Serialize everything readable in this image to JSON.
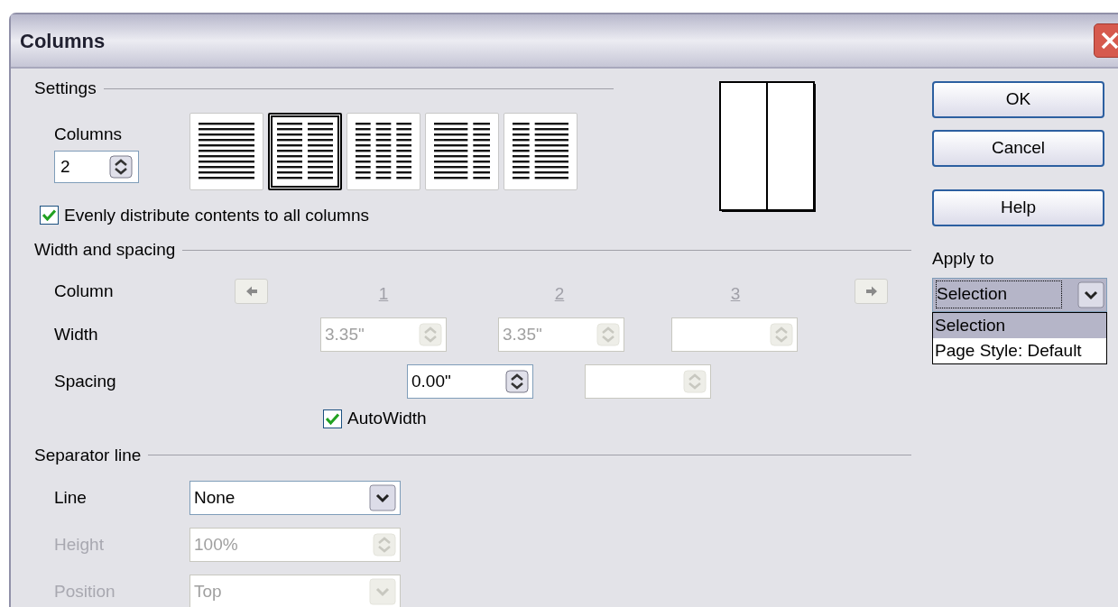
{
  "window": {
    "title": "Columns"
  },
  "settings": {
    "heading": "Settings",
    "columns": {
      "label": "Columns",
      "value": "2"
    },
    "layouts": [
      {
        "kind": "one",
        "selected": false
      },
      {
        "kind": "two",
        "selected": true
      },
      {
        "kind": "three",
        "selected": false
      },
      {
        "kind": "left-wide",
        "selected": false
      },
      {
        "kind": "right-wide",
        "selected": false
      }
    ],
    "evenly": {
      "label": "Evenly distribute contents to all columns",
      "checked": true
    }
  },
  "width_spacing": {
    "heading": "Width and spacing",
    "column_label": "Column",
    "column_numbers": [
      "1",
      "2",
      "3"
    ],
    "width_label": "Width",
    "widths": [
      {
        "value": "3.35\"",
        "disabled": true
      },
      {
        "value": "3.35\"",
        "disabled": true
      },
      {
        "disabled": true
      }
    ],
    "spacing_label": "Spacing",
    "spacings": [
      {
        "value": "0.00\"",
        "disabled": false
      },
      {
        "disabled": true
      }
    ],
    "autowidth": {
      "label": "AutoWidth",
      "checked": true
    }
  },
  "separator": {
    "heading": "Separator line",
    "rows": [
      {
        "label": "Line",
        "value": "None",
        "kind": "dropdown",
        "disabled": false
      },
      {
        "label": "Height",
        "value": "100%",
        "kind": "spin",
        "disabled": true
      },
      {
        "label": "Position",
        "value": "Top",
        "kind": "dropdown",
        "disabled": true
      }
    ]
  },
  "buttons": [
    {
      "label": "OK"
    },
    {
      "label": "Cancel"
    },
    {
      "label": "Help"
    }
  ],
  "apply_to": {
    "label": "Apply to",
    "value": "Selection",
    "options": [
      {
        "label": "Selection",
        "selected": true
      },
      {
        "label": "Page Style: Default",
        "selected": false
      }
    ]
  }
}
